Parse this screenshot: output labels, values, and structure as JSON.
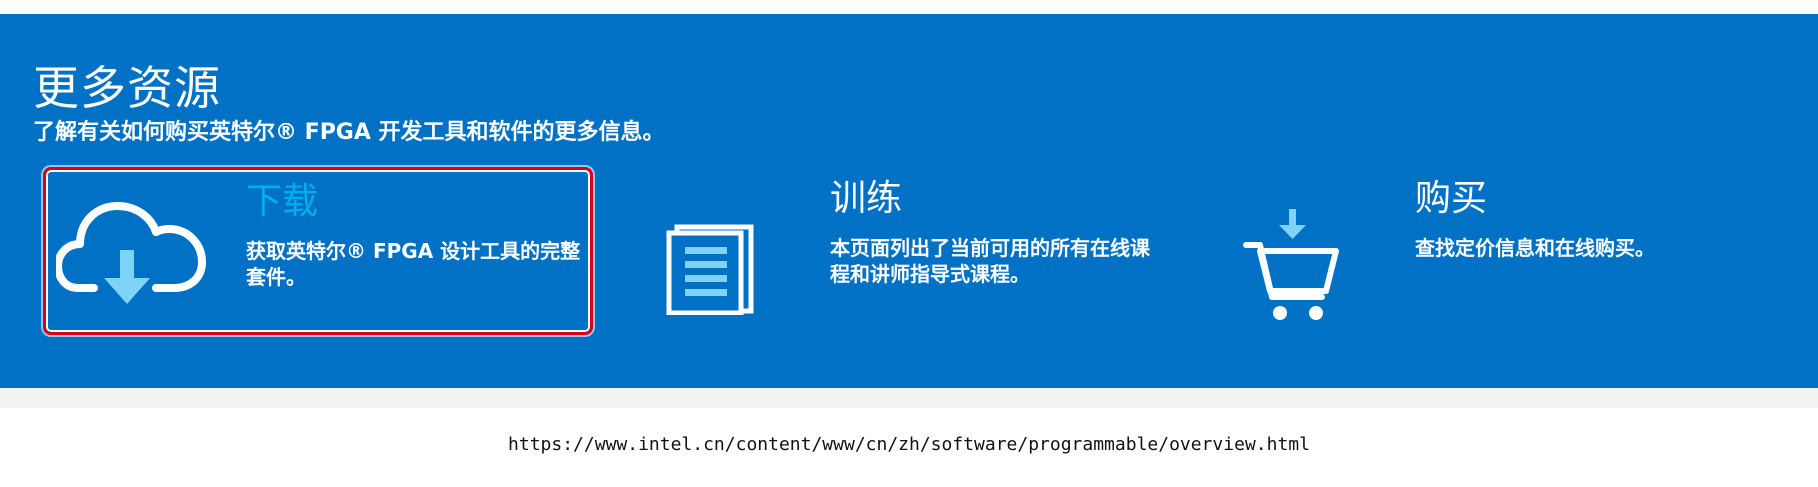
{
  "resources": {
    "title": "更多资源",
    "subtitle": "了解有关如何购买英特尔® FPGA 开发工具和软件的更多信息。",
    "cards": [
      {
        "id": "download",
        "icon": "cloud-download-icon",
        "title": "下载",
        "description": "获取英特尔® FPGA 设计工具的完整套件。",
        "highlighted": true
      },
      {
        "id": "training",
        "icon": "book-icon",
        "title": "训练",
        "description": "本页面列出了当前可用的所有在线课程和讲师指导式课程。",
        "highlighted": false
      },
      {
        "id": "buy",
        "icon": "shopping-cart-icon",
        "title": "购买",
        "description": "查找定价信息和在线购买。",
        "highlighted": false
      }
    ]
  },
  "colors": {
    "background": "#0071c5",
    "accent_title": "#00aeef",
    "highlight_border": "#d9001e",
    "icon_accent": "#7fd3f7"
  },
  "page_url": "https://www.intel.cn/content/www/cn/zh/software/programmable/overview.html"
}
